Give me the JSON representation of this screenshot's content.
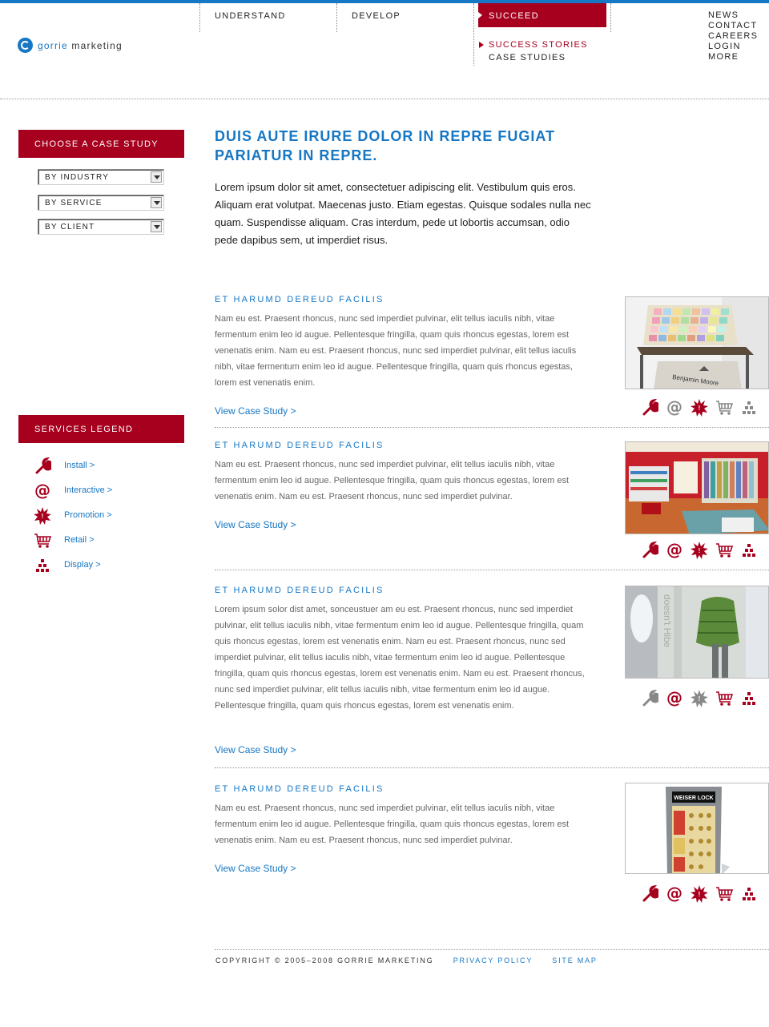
{
  "brand": {
    "name_part1": "gorrie",
    "name_part2": " marketing"
  },
  "nav": {
    "understand": "UNDERSTAND",
    "develop": "DEVELOP",
    "succeed": "SUCCEED",
    "sub_success": "SUCCESS STORIES",
    "sub_case": "CASE STUDIES"
  },
  "utility": [
    "NEWS",
    "CONTACT",
    "CAREERS",
    "LOGIN",
    "MORE"
  ],
  "sidebar": {
    "choose_heading": "CHOOSE A CASE STUDY",
    "filters": [
      "BY INDUSTRY",
      "BY SERVICE",
      "BY CLIENT"
    ],
    "legend_heading": "SERVICES LEGEND",
    "legend": [
      {
        "label": "Install >",
        "icon": "wrench-icon"
      },
      {
        "label": "Interactive >",
        "icon": "at-icon"
      },
      {
        "label": "Promotion >",
        "icon": "burst-icon"
      },
      {
        "label": "Retail >",
        "icon": "cart-icon"
      },
      {
        "label": "Display >",
        "icon": "display-icon"
      }
    ]
  },
  "hero": {
    "title": "DUIS AUTE IRURE DOLOR IN REPRE FUGIAT PARIATUR IN REPRE.",
    "body": "Lorem ipsum dolor sit amet, consectetuer adipiscing elit. Vestibulum quis eros. Aliquam erat volutpat. Maecenas justo. Etiam egestas. Quisque sodales nulla nec quam. Suspendisse aliquam. Cras interdum, pede ut lobortis accumsan, odio pede dapibus sem, ut imperdiet risus."
  },
  "cases": [
    {
      "title": "ET HARUMD DEREUD FACILIS",
      "body": "Nam eu est. Praesent rhoncus, nunc sed imperdiet pulvinar, elit tellus iaculis nibh, vitae fermentum enim leo id augue. Pellentesque fringilla, quam quis rhoncus egestas, lorem est venenatis enim. Nam eu est. Praesent rhoncus, nunc sed imperdiet pulvinar, elit tellus iaculis nibh, vitae fermentum enim leo id augue. Pellentesque fringilla, quam quis rhoncus egestas, lorem est venenatis enim.",
      "link": "View Case Study >",
      "image_text": "Benjamin Moore",
      "services_active": [
        true,
        false,
        true,
        false,
        false
      ]
    },
    {
      "title": "ET HARUMD DEREUD FACILIS",
      "body": "Nam eu est. Praesent rhoncus, nunc sed imperdiet pulvinar, elit tellus iaculis nibh, vitae fermentum enim leo id augue. Pellentesque fringilla, quam quis rhoncus egestas, lorem est venenatis enim. Nam eu est. Praesent rhoncus, nunc sed imperdiet pulvinar.",
      "link": "View Case Study >",
      "image_text": "",
      "services_active": [
        true,
        true,
        true,
        true,
        true
      ]
    },
    {
      "title": "ET HARUMD DEREUD FACILIS",
      "body": "Lorem ipsum solor dist amet, sonceustuer am eu est. Praesent rhoncus, nunc sed imperdiet pulvinar, elit tellus iaculis nibh, vitae fermentum enim leo id augue. Pellentesque fringilla, quam quis rhoncus egestas, lorem est venenatis enim. Nam eu est. Praesent rhoncus, nunc sed imperdiet pulvinar, elit tellus iaculis nibh, vitae fermentum enim leo id augue. Pellentesque fringilla, quam quis rhoncus egestas, lorem est venenatis enim. Nam eu est. Praesent rhoncus, nunc sed imperdiet pulvinar, elit tellus iaculis nibh, vitae fermentum enim leo id augue. Pellentesque fringilla, quam quis rhoncus egestas, lorem est venenatis enim.",
      "link": "View Case Study >",
      "image_text": "doesn't Hibe",
      "services_active": [
        false,
        true,
        false,
        true,
        true
      ]
    },
    {
      "title": "ET HARUMD DEREUD FACILIS",
      "body": "Nam eu est. Praesent rhoncus, nunc sed imperdiet pulvinar, elit tellus iaculis nibh, vitae fermentum enim leo id augue. Pellentesque fringilla, quam quis rhoncus egestas, lorem est venenatis enim. Nam eu est. Praesent rhoncus, nunc sed imperdiet pulvinar.",
      "link": "View Case Study >",
      "image_text": "WEISER LOCK",
      "services_active": [
        true,
        true,
        true,
        true,
        true
      ]
    }
  ],
  "footer": {
    "copyright": "COPYRIGHT © 2005–2008 GORRIE MARKETING",
    "privacy": "PRIVACY POLICY",
    "sitemap": "SITE MAP"
  },
  "colors": {
    "accent_blue": "#1677c4",
    "accent_red": "#a6001e",
    "inactive_gray": "#888888"
  }
}
